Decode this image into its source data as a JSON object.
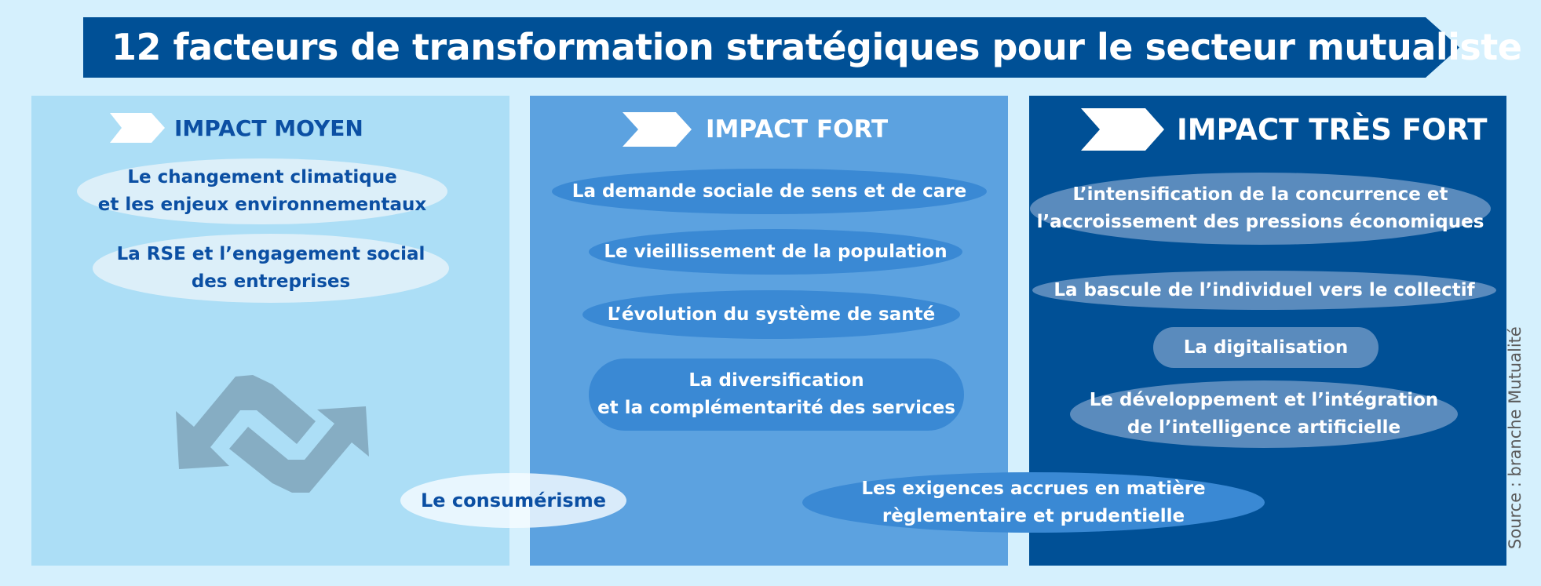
{
  "title": "12 facteurs de transformation stratégiques pour le secteur mutualiste",
  "colors": {
    "background": "#d5f0fd",
    "banner": "#005096",
    "panel_moyen": "#acdef6",
    "panel_fort": "#5ca2e0",
    "panel_tres_fort": "#005096",
    "pill_light": "#dceff9",
    "pill_mid": "#3a89d4",
    "pill_dark": "#5a8bbd",
    "text_dark_blue": "#0b4fa3"
  },
  "panels": [
    {
      "id": "moyen",
      "title": "IMPACT MOYEN",
      "icon": "chevron-right-icon",
      "factors": [
        "Le changement climatique\net les enjeux environnementaux",
        "La RSE et l’engagement social\ndes entreprises"
      ],
      "decoration": "exchange-arrows-icon"
    },
    {
      "id": "fort",
      "title": "IMPACT FORT",
      "icon": "chevron-right-icon",
      "factors": [
        "La demande sociale de sens et de care",
        "Le vieillissement de la population",
        "L’évolution du système de santé",
        "La diversification\net la complémentarité des services"
      ]
    },
    {
      "id": "tres_fort",
      "title": "IMPACT TRÈS FORT",
      "icon": "chevron-right-icon",
      "factors": [
        "L’intensification de la concurrence  et\nl’accroissement des pressions économiques",
        "La bascule de l’individuel vers le collectif",
        "La digitalisation",
        "Le développement et l’intégration\nde l’intelligence artificielle"
      ]
    }
  ],
  "bridging_factors": [
    {
      "label": "Le consumérisme",
      "between": "IMPACT MOYEN / IMPACT FORT"
    },
    {
      "label": "Les exigences accrues en matière\nrèglementaire et prudentielle",
      "between": "IMPACT FORT / IMPACT TRÈS FORT"
    }
  ],
  "source": "Source : branche Mutualité"
}
